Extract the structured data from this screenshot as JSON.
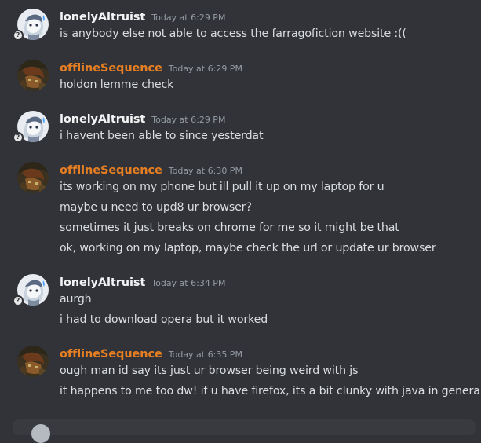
{
  "colors": {
    "background": "#313338",
    "username_default": "#f2f3f5",
    "username_orange": "#e67e22",
    "timestamp": "#949ba4",
    "message_text": "#dbdee1"
  },
  "status_badge_glyph": "?",
  "messages": [
    {
      "username": "lonelyAltruist",
      "timestamp": "Today at 6:29 PM",
      "avatar": "lonelyaltruist-avatar",
      "lines": [
        "is anybody else not able to access the farragofiction website :(("
      ]
    },
    {
      "username": "offlineSequence",
      "timestamp": "Today at 6:29 PM",
      "avatar": "offlinesequence-avatar",
      "lines": [
        "holdon lemme check"
      ]
    },
    {
      "username": "lonelyAltruist",
      "timestamp": "Today at 6:29 PM",
      "avatar": "lonelyaltruist-avatar",
      "lines": [
        "i havent been able to since yesterdat"
      ]
    },
    {
      "username": "offlineSequence",
      "timestamp": "Today at 6:30 PM",
      "avatar": "offlinesequence-avatar",
      "lines": [
        "its working on my phone but ill pull it up on my laptop for u",
        "maybe u need to upd8 ur browser?",
        "sometimes it just breaks on chrome for me so it might be that",
        "ok, working on my laptop, maybe check the url or update ur browser"
      ]
    },
    {
      "username": "lonelyAltruist",
      "timestamp": "Today at 6:34 PM",
      "avatar": "lonelyaltruist-avatar",
      "lines": [
        "aurgh",
        "i had to download opera but it worked"
      ]
    },
    {
      "username": "offlineSequence",
      "timestamp": "Today at 6:35 PM",
      "avatar": "offlinesequence-avatar",
      "lines": [
        "ough man id say its just ur browser being weird with js",
        "it happens to me too dw! if u have firefox, its a bit clunky with java in general"
      ]
    }
  ]
}
